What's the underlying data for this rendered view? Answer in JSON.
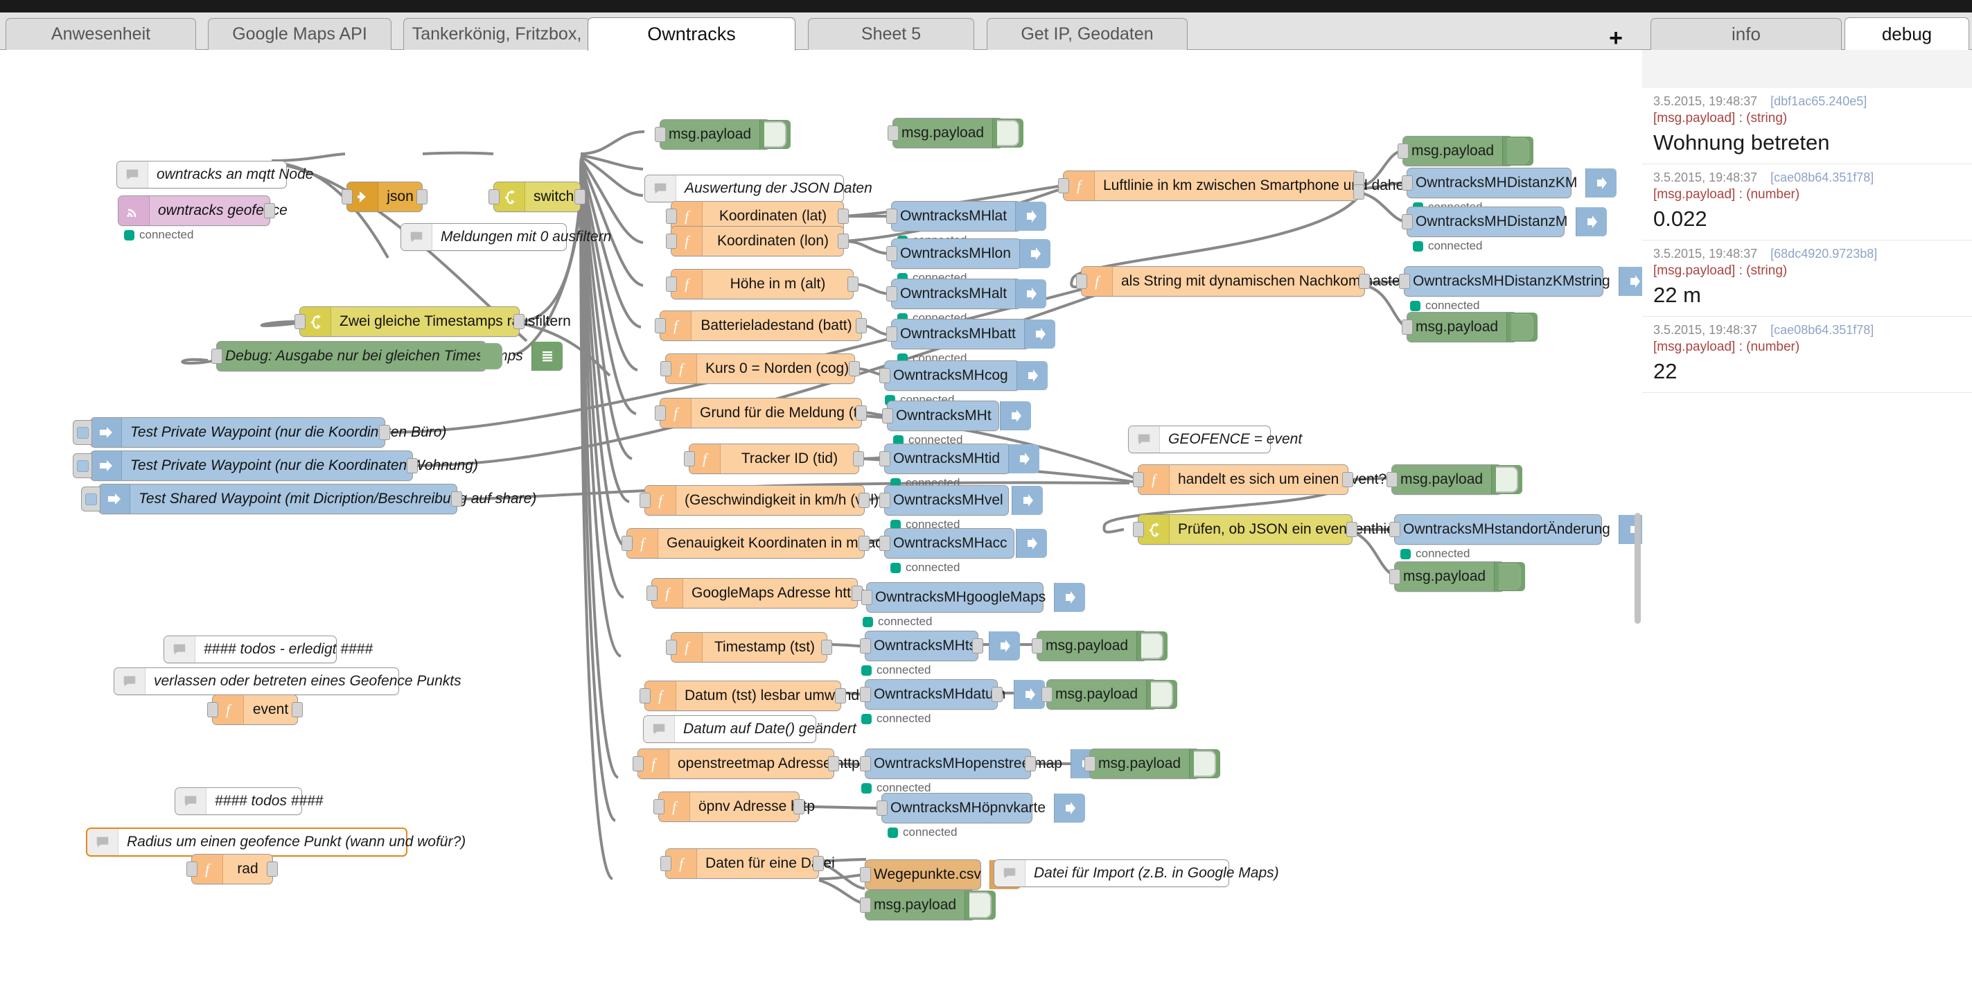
{
  "window": {
    "add_tab_label": "+"
  },
  "tabs": [
    {
      "label": "Anwesenheit",
      "active": false
    },
    {
      "label": "Google Maps API",
      "active": false
    },
    {
      "label": "Tankerkönig, Fritzbox,",
      "active": false
    },
    {
      "label": "Owntracks",
      "active": true
    },
    {
      "label": "Sheet 5",
      "active": false
    },
    {
      "label": "Get IP, Geodaten",
      "active": false
    }
  ],
  "sidebar": {
    "tabs": [
      {
        "label": "info",
        "active": false
      },
      {
        "label": "debug",
        "active": true
      }
    ],
    "messages": [
      {
        "time": "3.5.2015, 19:48:37",
        "id": "[dbf1ac65.240e5]",
        "topic": "[msg.payload] : (string)",
        "value": "Wohnung betreten"
      },
      {
        "time": "3.5.2015, 19:48:37",
        "id": "[cae08b64.351f78]",
        "topic": "[msg.payload] : (number)",
        "value": "0.022"
      },
      {
        "time": "3.5.2015, 19:48:37",
        "id": "[68dc4920.9723b8]",
        "topic": "[msg.payload] : (string)",
        "value": "22 m"
      },
      {
        "time": "3.5.2015, 19:48:37",
        "id": "[cae08b64.351f78]",
        "topic": "[msg.payload] : (number)",
        "value": "22"
      }
    ]
  },
  "status_label": "connected",
  "nodes": {
    "comment_mqtt_node": "owntracks an mqtt Node",
    "mqtt_in": "owntracks geofence",
    "json": "json",
    "switch": "switch",
    "comment_filter0": "Meldungen mit 0 ausfiltern",
    "debug_payload_top": "msg.payload",
    "comment_auswertung": "Auswertung der JSON Daten",
    "fn_lat": "Koordinaten (lat)",
    "fn_lon": "Koordinaten (lon)",
    "fn_alt": "Höhe in m (alt)",
    "fn_batt": "Batterieladestand (batt)",
    "fn_cog": "Kurs 0 = Norden (cog)",
    "fn_t": "Grund für die Meldung (t)",
    "fn_tid": "Tracker ID (tid)",
    "fn_vel": "(Geschwindigkeit in km/h (vel)",
    "fn_acc": "Genauigkeit Koordinaten in m (acc)",
    "fn_gmaps": "GoogleMaps Adresse https",
    "fn_tst": "Timestamp (tst)",
    "fn_datum": "Datum (tst) lesbar umwandeln",
    "comment_datum": "Datum auf Date() geändert",
    "fn_osm": "openstreetmap Adresse http",
    "fn_opnv": "öpnv Adresse http",
    "fn_datei": "Daten für eine Datei",
    "switch_timestamps": "Zwei gleiche Timestamps rausfiltern",
    "debug_timestamps": "Debug: Ausgabe nur bei gleichen Timestamps",
    "inject_buero": "Test Private Waypoint (nur die Koordinaten Büro)",
    "inject_wohnung": "Test Private Waypoint (nur die Koordinaten Wohnung)",
    "inject_share": "Test Shared Waypoint (mit Dicription/Beschreibung auf share)",
    "comment_todos_erledigt": "#### todos - erledigt ####",
    "comment_geofence_punkt": "verlassen oder betreten eines Geofence Punkts",
    "fn_event": "event",
    "comment_todos": "#### todos ####",
    "comment_radius": "Radius um einen geofence Punkt (wann und wofür?)",
    "fn_rad": "rad",
    "mqtt_lat": "OwntracksMHlat",
    "mqtt_lon": "OwntracksMHlon",
    "mqtt_alt": "OwntracksMHalt",
    "mqtt_batt": "OwntracksMHbatt",
    "mqtt_cog": "OwntracksMHcog",
    "mqtt_t": "OwntracksMHt",
    "mqtt_tid": "OwntracksMHtid",
    "mqtt_vel": "OwntracksMHvel",
    "mqtt_acc": "OwntracksMHacc",
    "mqtt_gmaps": "OwntracksMHgoogleMaps",
    "mqtt_tst": "OwntracksMHtst",
    "mqtt_datum": "OwntracksMHdatum",
    "mqtt_osm": "OwntracksMHopenstreetmap",
    "mqtt_opnv": "OwntracksMHöpnvkarte",
    "debug_payload_mid": "msg.payload",
    "debug_payload_tst": "msg.payload",
    "debug_payload_datum": "msg.payload",
    "debug_payload_osm": "msg.payload",
    "debug_payload_datei": "msg.payload",
    "file_csv": "Wegepunkte.csv",
    "comment_datei": "Datei für Import (z.B. in Google Maps)",
    "fn_luftlinie": "Luftlinie in km zwischen Smartphone und daheim",
    "fn_string_nachkomma": "als String mit dynamischen Nachkommastellen",
    "debug_payload_dist": "msg.payload",
    "mqtt_distkm": "OwntracksMHDistanzKM",
    "mqtt_distm": "OwntracksMHDistanzM",
    "mqtt_distkmstring": "OwntracksMHDistanzKMstring",
    "debug_payload_kmstring": "msg.payload",
    "comment_geofence_event": "GEOFENCE = event",
    "fn_event_check": "handelt es sich um einen event?",
    "debug_payload_event": "msg.payload",
    "switch_json_event": "Prüfen, ob JSON ein event enthielt",
    "mqtt_standort": "OwntracksMHstandortÄnderung",
    "debug_payload_standort": "msg.payload"
  },
  "colors": {
    "function": "#fdd0a2",
    "switch": "#e2d96e",
    "json": "#e7ae46",
    "mqtt_in": "#e3c0dc",
    "mqtt_out": "#a7c5e0",
    "debug": "#85ad7e",
    "file": "#e6b577",
    "status_connected": "#00a887",
    "debug_topic": "#a94442",
    "debug_id": "#8fa3c7"
  }
}
